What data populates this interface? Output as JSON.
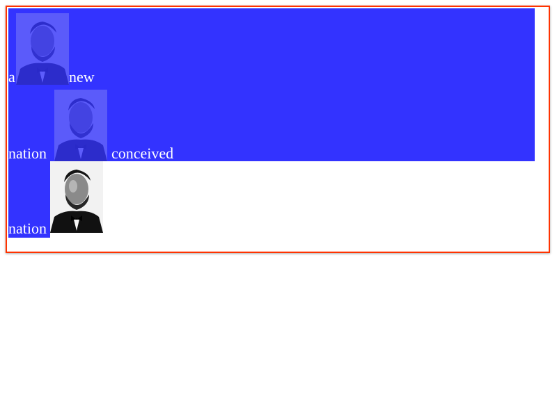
{
  "lines": [
    {
      "before": "a",
      "after": "new"
    },
    {
      "before": "nation",
      "after": "conceived"
    },
    {
      "before": "nation",
      "after": ""
    }
  ],
  "colors": {
    "highlight": "#3333ff",
    "frame_border": "#ff3300",
    "text": "#ffffff"
  },
  "images": [
    {
      "icon": "portrait-image",
      "tinted": true
    },
    {
      "icon": "portrait-image",
      "tinted": true
    },
    {
      "icon": "portrait-image",
      "tinted": false
    }
  ]
}
